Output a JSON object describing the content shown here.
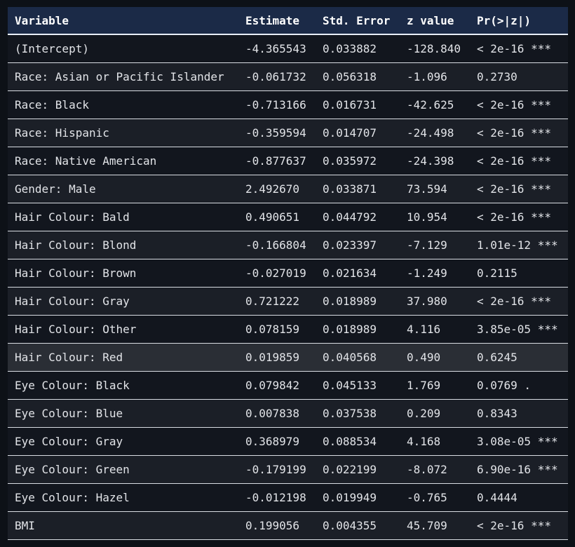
{
  "table": {
    "headers": [
      "Variable",
      "Estimate",
      "Std. Error",
      "z value",
      "Pr(>|z|)"
    ],
    "rows": [
      {
        "variable": "(Intercept)",
        "estimate": "-4.365543",
        "std_error": "0.033882",
        "z_value": "-128.840",
        "p": "< 2e-16 ***"
      },
      {
        "variable": "Race: Asian or Pacific Islander",
        "estimate": "-0.061732",
        "std_error": "0.056318",
        "z_value": "-1.096",
        "p": "0.2730"
      },
      {
        "variable": "Race: Black",
        "estimate": "-0.713166",
        "std_error": "0.016731",
        "z_value": "-42.625",
        "p": "< 2e-16 ***"
      },
      {
        "variable": "Race: Hispanic",
        "estimate": "-0.359594",
        "std_error": "0.014707",
        "z_value": "-24.498",
        "p": "< 2e-16 ***"
      },
      {
        "variable": "Race: Native American",
        "estimate": "-0.877637",
        "std_error": "0.035972",
        "z_value": "-24.398",
        "p": "< 2e-16 ***"
      },
      {
        "variable": "Gender: Male",
        "estimate": "2.492670",
        "std_error": "0.033871",
        "z_value": "73.594",
        "p": "< 2e-16 ***"
      },
      {
        "variable": "Hair Colour: Bald",
        "estimate": "0.490651",
        "std_error": "0.044792",
        "z_value": "10.954",
        "p": "< 2e-16 ***"
      },
      {
        "variable": "Hair Colour: Blond",
        "estimate": "-0.166804",
        "std_error": "0.023397",
        "z_value": "-7.129",
        "p": "1.01e-12 ***"
      },
      {
        "variable": "Hair Colour: Brown",
        "estimate": "-0.027019",
        "std_error": "0.021634",
        "z_value": "-1.249",
        "p": "0.2115"
      },
      {
        "variable": "Hair Colour: Gray",
        "estimate": "0.721222",
        "std_error": "0.018989",
        "z_value": "37.980",
        "p": "< 2e-16 ***"
      },
      {
        "variable": "Hair Colour: Other",
        "estimate": "0.078159",
        "std_error": "0.018989",
        "z_value": "4.116",
        "p": "3.85e-05 ***"
      },
      {
        "variable": "Hair Colour: Red",
        "estimate": "0.019859",
        "std_error": "0.040568",
        "z_value": "0.490",
        "p": "0.6245"
      },
      {
        "variable": "Eye Colour: Black",
        "estimate": "0.079842",
        "std_error": "0.045133",
        "z_value": "1.769",
        "p": "0.0769 ."
      },
      {
        "variable": "Eye Colour: Blue",
        "estimate": "0.007838",
        "std_error": "0.037538",
        "z_value": "0.209",
        "p": "0.8343"
      },
      {
        "variable": "Eye Colour: Gray",
        "estimate": "0.368979",
        "std_error": "0.088534",
        "z_value": "4.168",
        "p": "3.08e-05 ***"
      },
      {
        "variable": "Eye Colour: Green",
        "estimate": "-0.179199",
        "std_error": "0.022199",
        "z_value": "-8.072",
        "p": "6.90e-16 ***"
      },
      {
        "variable": "Eye Colour: Hazel",
        "estimate": "-0.012198",
        "std_error": "0.019949",
        "z_value": "-0.765",
        "p": "0.4444"
      },
      {
        "variable": "BMI",
        "estimate": "0.199056",
        "std_error": "0.004355",
        "z_value": "45.709",
        "p": "< 2e-16 ***"
      }
    ]
  },
  "colors": {
    "header_bg": "#1b2a47",
    "page_bg": "#0d1117",
    "highlight_row": "#2a2e35"
  }
}
